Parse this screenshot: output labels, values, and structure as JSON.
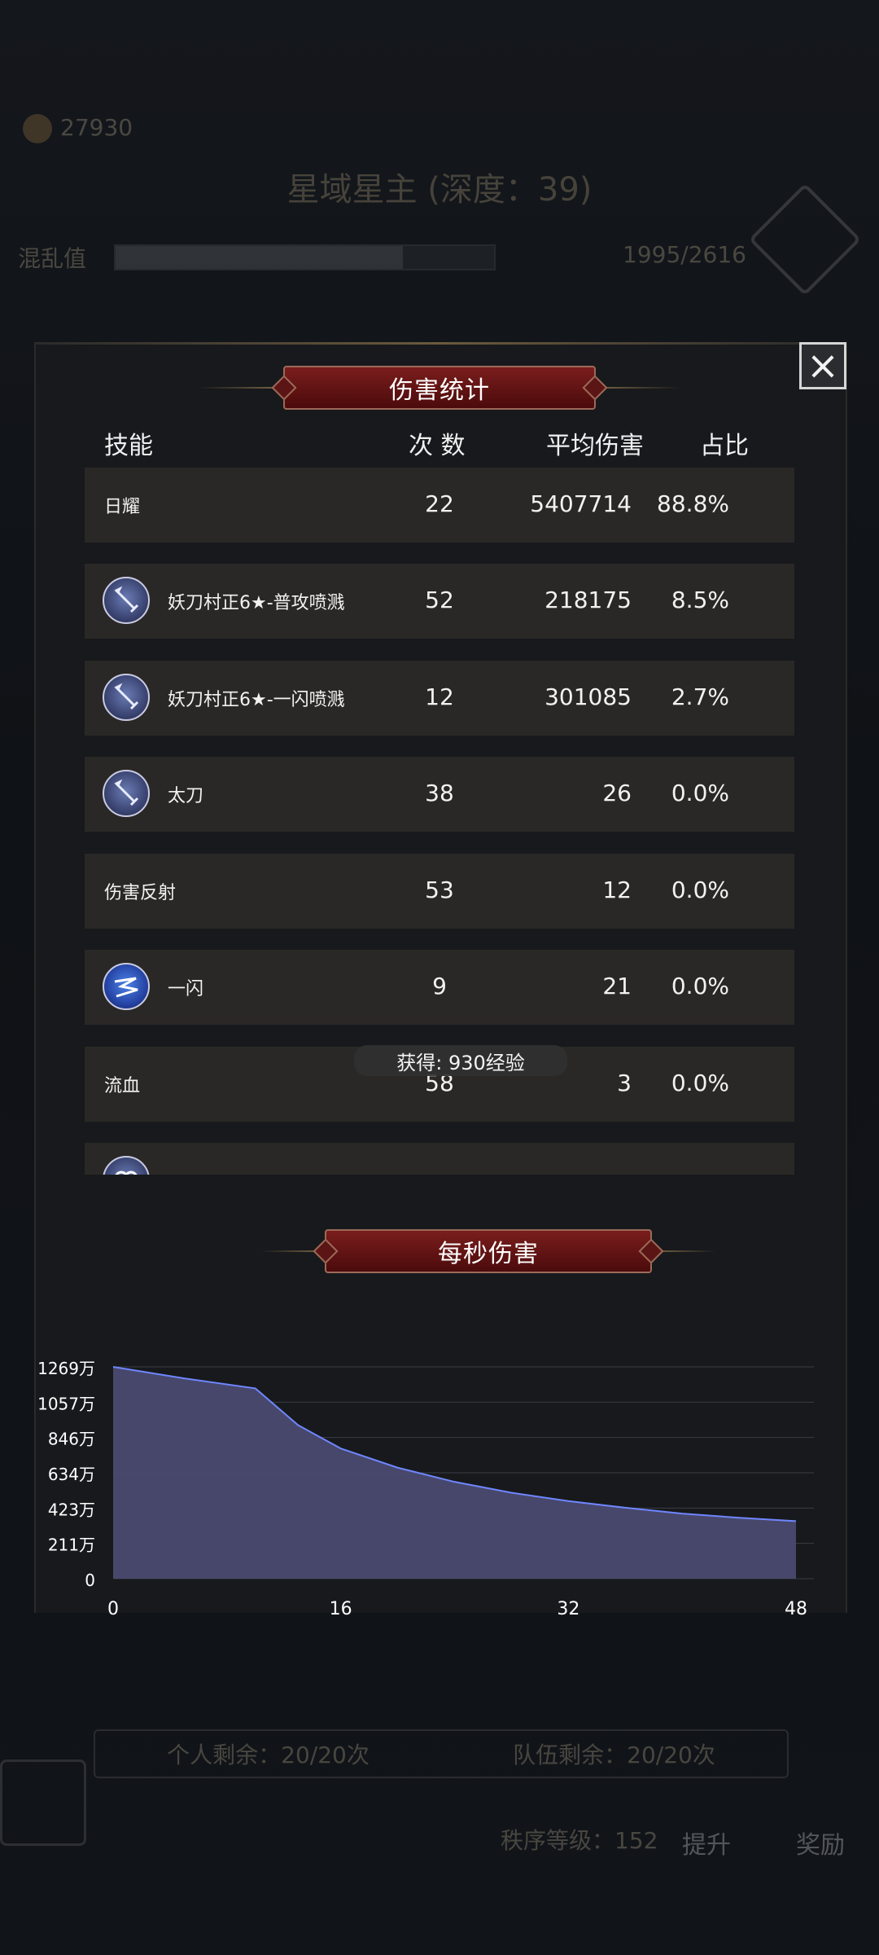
{
  "background": {
    "gold_amount": "27930",
    "stage_title": "星域星主 (深度：39)",
    "chaos_label": "混乱值",
    "chaos_value": "1995/2616",
    "chaos_fraction": 0.76,
    "personal_remaining": "个人剩余：20/20次",
    "team_remaining": "队伍剩余：20/20次",
    "order_level": "秩序等级：152",
    "upgrade_label": "提升",
    "reward_label": "奖励"
  },
  "damage_panel": {
    "title": "伤害统计",
    "columns": {
      "skill": "技能",
      "count": "次 数",
      "avg": "平均伤害",
      "ratio": "占比"
    },
    "rows": [
      {
        "name": "日耀",
        "icon": null,
        "count": "22",
        "avg": "5407714",
        "ratio": "88.8%"
      },
      {
        "name": "妖刀村正6★-普攻喷溅",
        "icon": "sword-icon",
        "count": "52",
        "avg": "218175",
        "ratio": "8.5%"
      },
      {
        "name": "妖刀村正6★-一闪喷溅",
        "icon": "sword-icon",
        "count": "12",
        "avg": "301085",
        "ratio": "2.7%"
      },
      {
        "name": "太刀",
        "icon": "sword-icon",
        "count": "38",
        "avg": "26",
        "ratio": "0.0%"
      },
      {
        "name": "伤害反射",
        "icon": null,
        "count": "53",
        "avg": "12",
        "ratio": "0.0%"
      },
      {
        "name": "一闪",
        "icon": "flash-icon",
        "count": "9",
        "avg": "21",
        "ratio": "0.0%"
      },
      {
        "name": "流血",
        "icon": null,
        "count": "58",
        "avg": "3",
        "ratio": "0.0%"
      },
      {
        "name": "",
        "icon": "swirl-icon",
        "count": "",
        "avg": "",
        "ratio": ""
      }
    ],
    "toast": "获得: 930经验"
  },
  "dps_panel": {
    "title": "每秒伤害"
  },
  "chart_data": {
    "type": "area",
    "title": "每秒伤害",
    "x": [
      0,
      5,
      10,
      13,
      16,
      20,
      24,
      28,
      32,
      36,
      40,
      44,
      48
    ],
    "y": [
      1269,
      1200,
      1140,
      920,
      780,
      665,
      580,
      515,
      465,
      425,
      390,
      365,
      345
    ],
    "yticks": [
      "0",
      "211万",
      "423万",
      "634万",
      "846万",
      "1057万",
      "1269万"
    ],
    "xticks": [
      "0",
      "16",
      "32",
      "48"
    ],
    "ylim": [
      0,
      1269
    ],
    "xlim": [
      0,
      48
    ],
    "grid": true,
    "fill_color": "#4a4a70",
    "line_color": "#6f86ff"
  }
}
